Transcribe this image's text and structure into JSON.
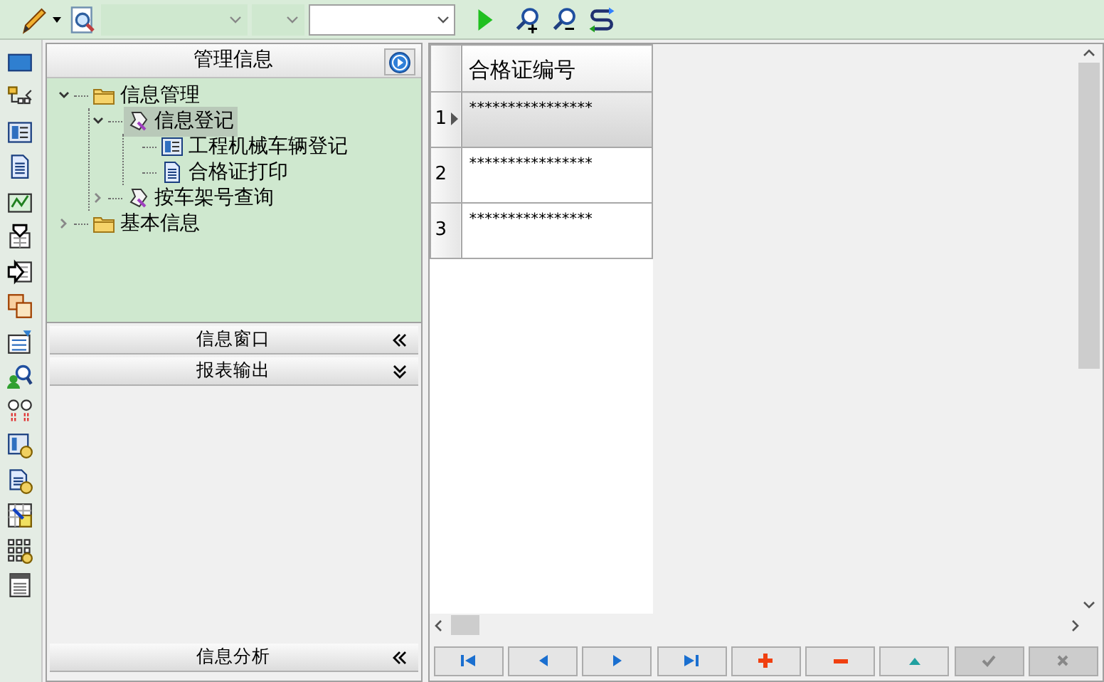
{
  "toolbar": {
    "combos": [
      {
        "disabled": true
      },
      {
        "disabled": true
      },
      {
        "disabled": false
      }
    ]
  },
  "tree_panel": {
    "title": "管理信息",
    "tree": [
      {
        "label": "信息管理",
        "kind": "folder",
        "expanded": true,
        "selected": false,
        "children": [
          {
            "label": "信息登记",
            "kind": "tool",
            "expanded": true,
            "selected": true,
            "children": [
              {
                "label": "工程机械车辆登记",
                "kind": "form",
                "selected": false
              },
              {
                "label": "合格证打印",
                "kind": "doc",
                "selected": false
              }
            ]
          },
          {
            "label": "按车架号查询",
            "kind": "tool",
            "expanded": false,
            "selected": false
          }
        ]
      },
      {
        "label": "基本信息",
        "kind": "folder",
        "expanded": false,
        "selected": false
      }
    ]
  },
  "sections": [
    {
      "title": "信息窗口",
      "expanded": false
    },
    {
      "title": "报表输出",
      "expanded": true
    },
    {
      "title": "信息分析",
      "expanded": false
    }
  ],
  "grid": {
    "columns": [
      "合格证编号"
    ],
    "rows": [
      {
        "number": "1",
        "selected": true,
        "cells": [
          "****************"
        ]
      },
      {
        "number": "2",
        "selected": false,
        "cells": [
          "****************"
        ]
      },
      {
        "number": "3",
        "selected": false,
        "cells": [
          "****************"
        ]
      }
    ]
  },
  "navigator": [
    {
      "kind": "first",
      "disabled": false
    },
    {
      "kind": "prior",
      "disabled": false
    },
    {
      "kind": "next",
      "disabled": false
    },
    {
      "kind": "last",
      "disabled": false
    },
    {
      "kind": "insert",
      "disabled": false
    },
    {
      "kind": "delete",
      "disabled": false
    },
    {
      "kind": "edit",
      "disabled": false
    },
    {
      "kind": "post",
      "disabled": true
    },
    {
      "kind": "cancel",
      "disabled": true
    }
  ]
}
